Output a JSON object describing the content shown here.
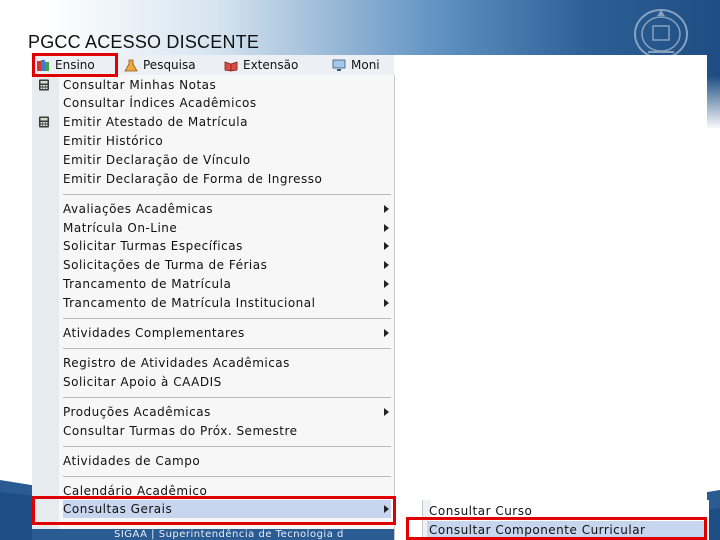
{
  "slide": {
    "title": "PGCC ACESSO DISCENTE"
  },
  "menubar": {
    "items": [
      {
        "label": "Ensino",
        "icon": "books-icon"
      },
      {
        "label": "Pesquisa",
        "icon": "flask-icon"
      },
      {
        "label": "Extensão",
        "icon": "book-open-icon"
      },
      {
        "label": "Moni",
        "icon": "monitor-icon"
      }
    ]
  },
  "menu": {
    "items": [
      {
        "label": "Consultar Minhas Notas",
        "icon": "calculator-icon",
        "submenu": false
      },
      {
        "label": "Consultar Índices Acadêmicos",
        "icon": "",
        "submenu": false
      },
      {
        "label": "Emitir Atestado de Matrícula",
        "icon": "calculator-icon",
        "submenu": false
      },
      {
        "label": "Emitir Histórico",
        "icon": "",
        "submenu": false
      },
      {
        "label": "Emitir Declaração de Vínculo",
        "icon": "",
        "submenu": false
      },
      {
        "label": "Emitir Declaração de Forma de Ingresso",
        "icon": "",
        "submenu": false
      },
      {
        "label": "Avaliações Acadêmicas",
        "icon": "",
        "submenu": true
      },
      {
        "label": "Matrícula On-Line",
        "icon": "",
        "submenu": true
      },
      {
        "label": "Solicitar Turmas Específicas",
        "icon": "",
        "submenu": true
      },
      {
        "label": "Solicitações de Turma de Férias",
        "icon": "",
        "submenu": true
      },
      {
        "label": "Trancamento de Matrícula",
        "icon": "",
        "submenu": true
      },
      {
        "label": "Trancamento de Matrícula Institucional",
        "icon": "",
        "submenu": true
      },
      {
        "label": "Atividades Complementares",
        "icon": "",
        "submenu": true
      },
      {
        "label": "Registro de Atividades Acadêmicas",
        "icon": "",
        "submenu": false
      },
      {
        "label": "Solicitar Apoio à CAADIS",
        "icon": "",
        "submenu": false
      },
      {
        "label": "Produções Acadêmicas",
        "icon": "",
        "submenu": true
      },
      {
        "label": "Consultar Turmas do Próx. Semestre",
        "icon": "",
        "submenu": false
      },
      {
        "label": "Atividades de Campo",
        "icon": "",
        "submenu": false
      },
      {
        "label": "Calendário Acadêmico",
        "icon": "",
        "submenu": false
      },
      {
        "label": "Consultas Gerais",
        "icon": "",
        "submenu": true
      }
    ]
  },
  "submenu": {
    "items": [
      {
        "label": "Consultar Curso"
      },
      {
        "label": "Consultar Componente Curricular"
      }
    ]
  },
  "footer": {
    "text": "SIGAA | Superintendência de Tecnologia d"
  },
  "colors": {
    "highlight_border": "#e00000",
    "selected_item_bg": "#c7d6ee",
    "brand_blue": "#1e4d83"
  }
}
